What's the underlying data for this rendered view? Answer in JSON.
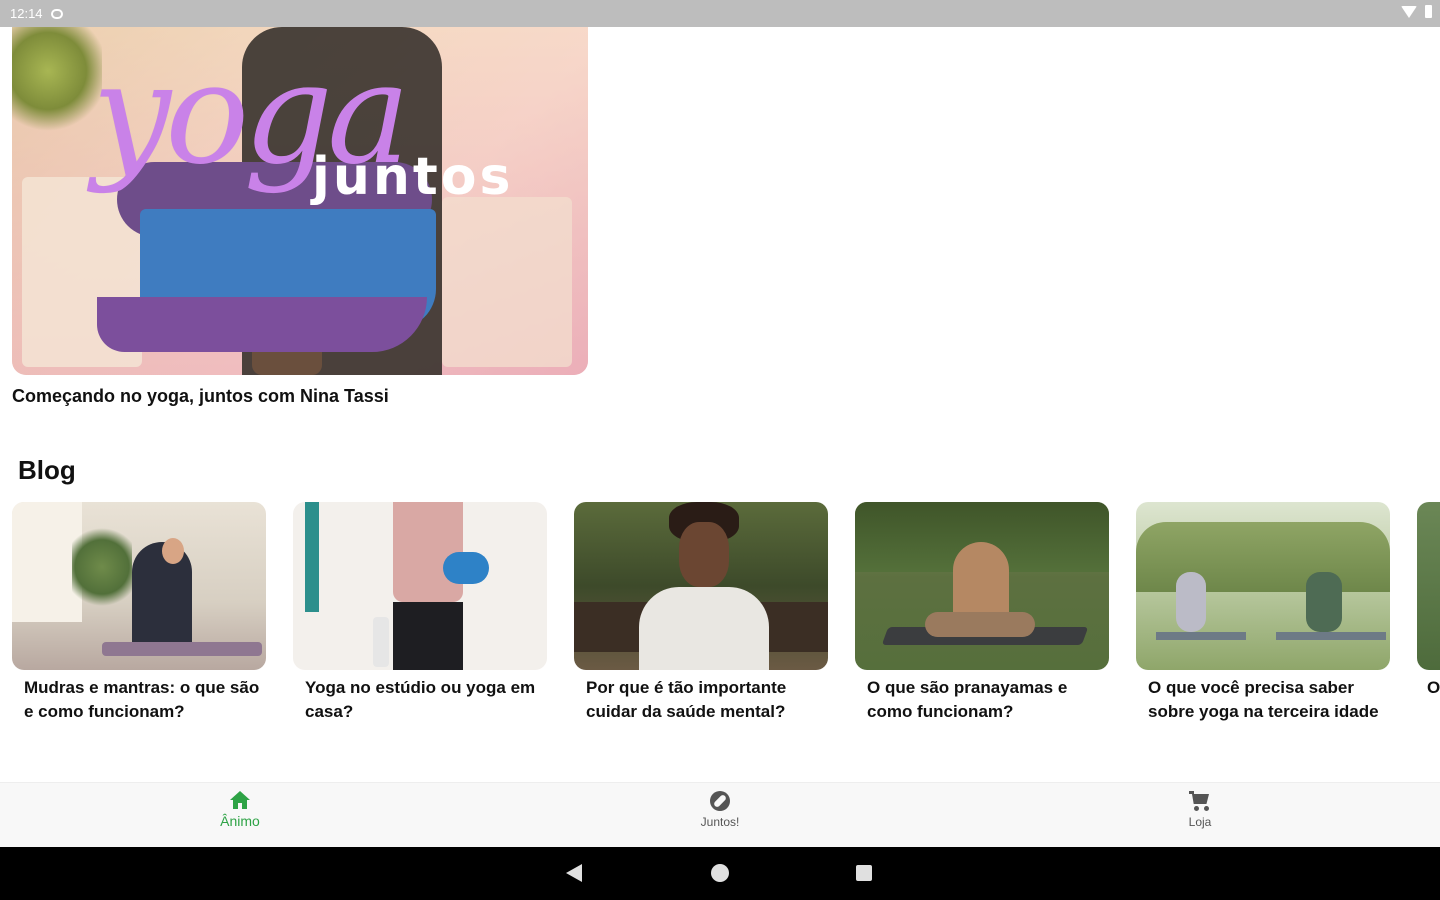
{
  "status_bar": {
    "time": "12:14"
  },
  "hero": {
    "script_text": "yoga",
    "overlay_word": "juntos",
    "caption": "Começando no yoga, juntos com Nina Tassi"
  },
  "blog": {
    "title": "Blog",
    "cards": [
      {
        "title": "Mudras e mantras: o que são e como funcionam?"
      },
      {
        "title": "Yoga no estúdio ou yoga em casa?"
      },
      {
        "title": "Por que é tão importante cuidar da saúde mental?"
      },
      {
        "title": "O que são pranayamas e como funcionam?"
      },
      {
        "title": "O que você precisa saber sobre yoga na terceira idade"
      },
      {
        "title": "O i"
      }
    ]
  },
  "bottom_nav": {
    "items": [
      {
        "label": "Ânimo",
        "icon": "home-icon",
        "active": true
      },
      {
        "label": "Juntos!",
        "icon": "compass-icon",
        "active": false
      },
      {
        "label": "Loja",
        "icon": "cart-icon",
        "active": false
      }
    ]
  },
  "colors": {
    "accent": "#2ea346",
    "script": "#c982e8"
  }
}
